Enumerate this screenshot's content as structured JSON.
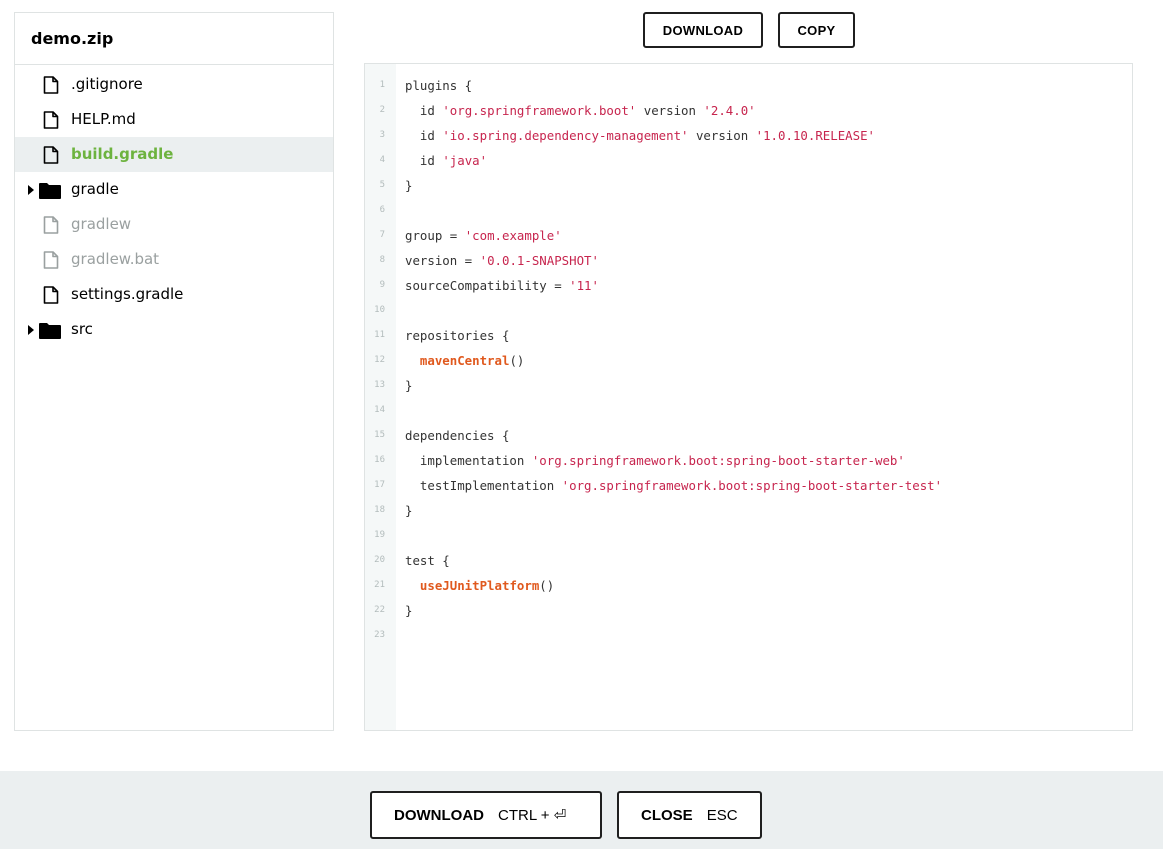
{
  "tree": {
    "title": "demo.zip",
    "items": [
      {
        "label": ".gitignore",
        "type": "file",
        "state": "normal"
      },
      {
        "label": "HELP.md",
        "type": "file",
        "state": "normal"
      },
      {
        "label": "build.gradle",
        "type": "file",
        "state": "selected"
      },
      {
        "label": "gradle",
        "type": "folder",
        "state": "normal"
      },
      {
        "label": "gradlew",
        "type": "file",
        "state": "disabled"
      },
      {
        "label": "gradlew.bat",
        "type": "file",
        "state": "disabled"
      },
      {
        "label": "settings.gradle",
        "type": "file",
        "state": "normal"
      },
      {
        "label": "src",
        "type": "folder",
        "state": "normal"
      }
    ]
  },
  "toolbar": {
    "download_label": "DOWNLOAD",
    "copy_label": "COPY"
  },
  "code": {
    "lines": [
      [
        [
          "t",
          "plugins {"
        ]
      ],
      [
        [
          "t",
          "  id "
        ],
        [
          "s",
          "'org.springframework.boot'"
        ],
        [
          "t",
          " version "
        ],
        [
          "s",
          "'2.4.0'"
        ]
      ],
      [
        [
          "t",
          "  id "
        ],
        [
          "s",
          "'io.spring.dependency-management'"
        ],
        [
          "t",
          " version "
        ],
        [
          "s",
          "'1.0.10.RELEASE'"
        ]
      ],
      [
        [
          "t",
          "  id "
        ],
        [
          "s",
          "'java'"
        ]
      ],
      [
        [
          "t",
          "}"
        ]
      ],
      [],
      [
        [
          "t",
          "group = "
        ],
        [
          "s",
          "'com.example'"
        ]
      ],
      [
        [
          "t",
          "version = "
        ],
        [
          "s",
          "'0.0.1-SNAPSHOT'"
        ]
      ],
      [
        [
          "t",
          "sourceCompatibility = "
        ],
        [
          "s",
          "'11'"
        ]
      ],
      [],
      [
        [
          "t",
          "repositories {"
        ]
      ],
      [
        [
          "t",
          "  "
        ],
        [
          "f",
          "mavenCentral"
        ],
        [
          "t",
          "()"
        ]
      ],
      [
        [
          "t",
          "}"
        ]
      ],
      [],
      [
        [
          "t",
          "dependencies {"
        ]
      ],
      [
        [
          "t",
          "  implementation "
        ],
        [
          "s",
          "'org.springframework.boot:spring-boot-starter-web'"
        ]
      ],
      [
        [
          "t",
          "  testImplementation "
        ],
        [
          "s",
          "'org.springframework.boot:spring-boot-starter-test'"
        ]
      ],
      [
        [
          "t",
          "}"
        ]
      ],
      [],
      [
        [
          "t",
          "test {"
        ]
      ],
      [
        [
          "t",
          "  "
        ],
        [
          "f",
          "useJUnitPlatform"
        ],
        [
          "t",
          "()"
        ]
      ],
      [
        [
          "t",
          "}"
        ]
      ],
      []
    ]
  },
  "footer": {
    "download_label": "DOWNLOAD",
    "download_shortcut": "CTRL + ⏎",
    "close_label": "CLOSE",
    "close_shortcut": "ESC"
  },
  "colors": {
    "accent_green": "#6db33f",
    "string": "#c7254e",
    "function": "#e0591e",
    "footer_bg": "#ebeff0"
  },
  "icons": {
    "file": "file-icon",
    "folder": "folder-icon",
    "caret": "caret-right-icon"
  }
}
